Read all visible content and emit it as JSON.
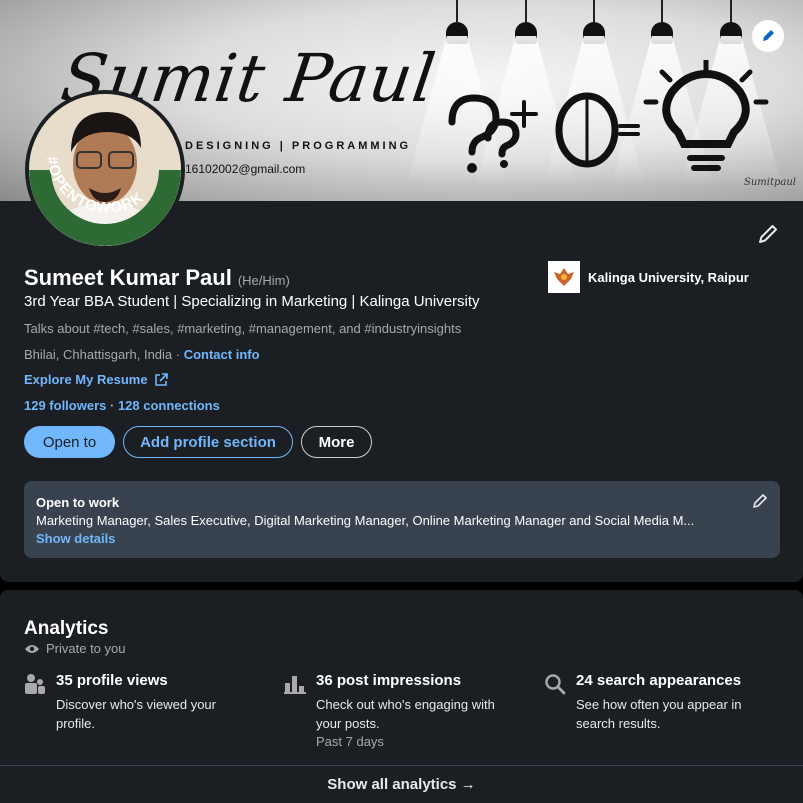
{
  "banner": {
    "name_art": "Sumit Paul",
    "tagline": "DESIGNING | PROGRAMMING",
    "email": "16102002@gmail.com",
    "signature": "Sumitpaul"
  },
  "badge": {
    "text": "#OPENTOWORK"
  },
  "profile": {
    "name": "Sumeet Kumar Paul",
    "pronouns": "(He/Him)",
    "headline": "3rd Year BBA Student | Specializing in Marketing | Kalinga University",
    "talks_about": "Talks about #tech, #sales, #marketing, #management, and #industryinsights",
    "location": "Bhilai, Chhattisgarh, India · ",
    "contact_info": "Contact info",
    "resume_link": "Explore My Resume",
    "followers": "129 followers",
    "separator": " · ",
    "connections": "128 connections"
  },
  "education": {
    "name": "Kalinga University, Raipur"
  },
  "actions": {
    "open_to": "Open to",
    "add_section": "Add profile section",
    "more": "More"
  },
  "open_to_work": {
    "title": "Open to work",
    "roles": "Marketing Manager, Sales Executive, Digital Marketing Manager, Online Marketing Manager and Social Media M...",
    "show_details": "Show details"
  },
  "analytics": {
    "title": "Analytics",
    "private": "Private to you",
    "metrics": [
      {
        "icon": "people-icon",
        "title": "35 profile views",
        "desc": "Discover who's viewed your profile.",
        "sub": ""
      },
      {
        "icon": "bar-chart-icon",
        "title": "36 post impressions",
        "desc": "Check out who's engaging with your posts.",
        "sub": "Past 7 days"
      },
      {
        "icon": "search-icon",
        "title": "24 search appearances",
        "desc": "See how often you appear in search results.",
        "sub": ""
      }
    ],
    "show_all": "Show all analytics →"
  },
  "colors": {
    "background": "#1b1f23",
    "accent": "#71b7fb",
    "muted": "#a9a9a9",
    "box": "#38434f",
    "otw_green": "#2e6b34"
  }
}
